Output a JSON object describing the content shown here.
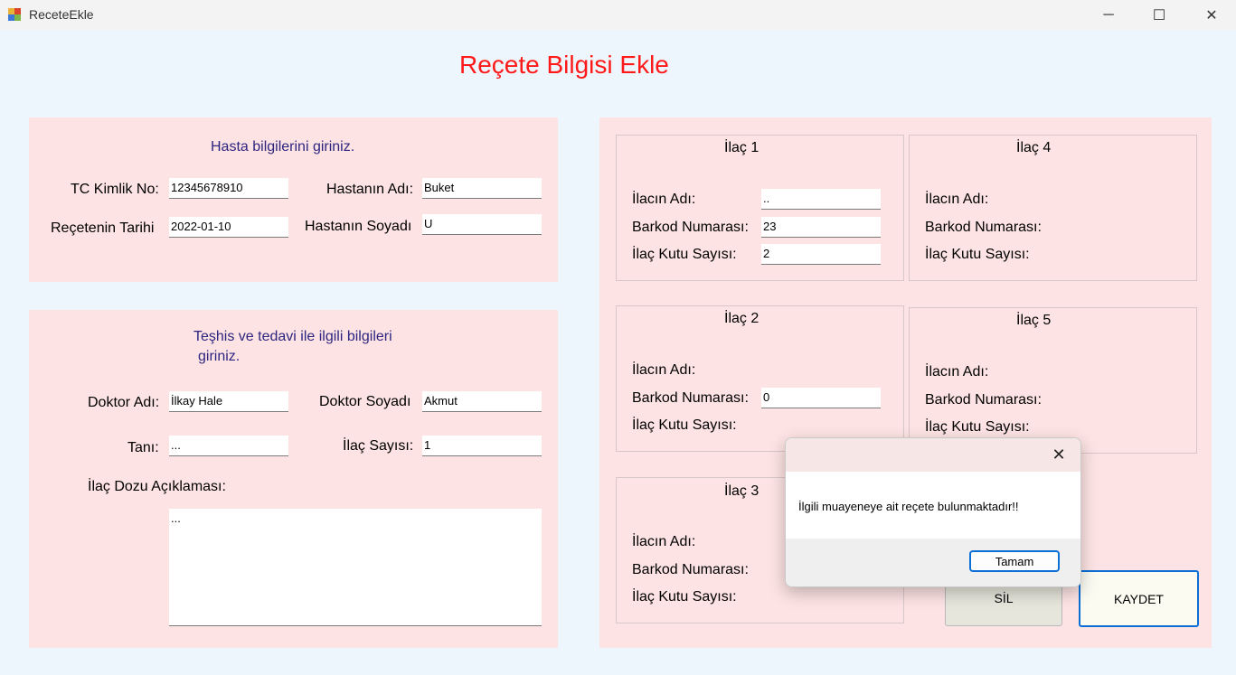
{
  "window": {
    "title": "ReceteEkle",
    "minimize_glyph": "─",
    "maximize_glyph": "☐",
    "close_glyph": "✕"
  },
  "headline": "Reçete Bilgisi Ekle",
  "patient": {
    "heading": "Hasta bilgilerini giriniz.",
    "tc_label": "TC Kimlik No:",
    "tc_value": "12345678910",
    "name_label": "Hastanın Adı:",
    "name_value": "Buket",
    "date_label": "Reçetenin Tarihi",
    "date_value": "2022-01-10",
    "surname_label": "Hastanın Soyadı",
    "surname_value": "U"
  },
  "treatment": {
    "heading_line1": "Teşhis ve tedavi ile ilgili bilgileri",
    "heading_line2": "giriniz.",
    "doctor_name_label": "Doktor Adı:",
    "doctor_name_value": "İlkay Hale",
    "doctor_surname_label": "Doktor Soyadı",
    "doctor_surname_value": "Akmut",
    "diagnosis_label": "Tanı:",
    "diagnosis_value": "...",
    "drug_count_label": "İlaç Sayısı:",
    "drug_count_value": "1",
    "dose_label": "İlaç Dozu Açıklaması:",
    "dose_value": "..."
  },
  "drugs": {
    "name_label": "İlacın Adı:",
    "barcode_label": "Barkod Numarası:",
    "box_label": "İlaç Kutu Sayısı:",
    "d1": {
      "title": "İlaç 1",
      "name_value": "..",
      "barcode_value": "23",
      "box_value": "2"
    },
    "d2": {
      "title": "İlaç 2",
      "barcode_value": "0"
    },
    "d3": {
      "title": "İlaç 3"
    },
    "d4": {
      "title": "İlaç 4"
    },
    "d5": {
      "title": "İlaç 5"
    }
  },
  "buttons": {
    "delete": "SİL",
    "save": "KAYDET"
  },
  "dialog": {
    "message": "İlgili muayeneye ait reçete bulunmaktadır!!",
    "ok": "Tamam",
    "close_glyph": "✕"
  },
  "colors": {
    "headline": "#ff1a1a",
    "panel": "#fde3e3",
    "heading_blue": "#2d2580",
    "accent": "#0b6fd6"
  }
}
